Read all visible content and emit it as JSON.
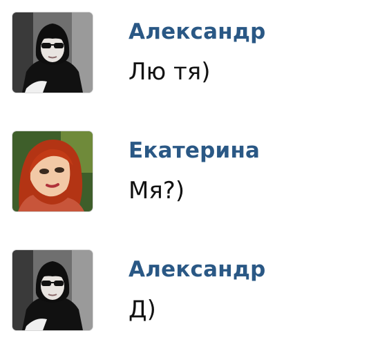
{
  "messages": [
    {
      "author": "Александр",
      "text": "Лю тя)",
      "avatar_icon": "avatar-man-sunglasses"
    },
    {
      "author": "Екатерина",
      "text": "Мя?)",
      "avatar_icon": "avatar-woman-red-hair"
    },
    {
      "author": "Александр",
      "text": "Д)",
      "avatar_icon": "avatar-man-sunglasses"
    }
  ],
  "colors": {
    "author_link": "#2a5885",
    "message_text": "#111111",
    "background": "#ffffff"
  }
}
